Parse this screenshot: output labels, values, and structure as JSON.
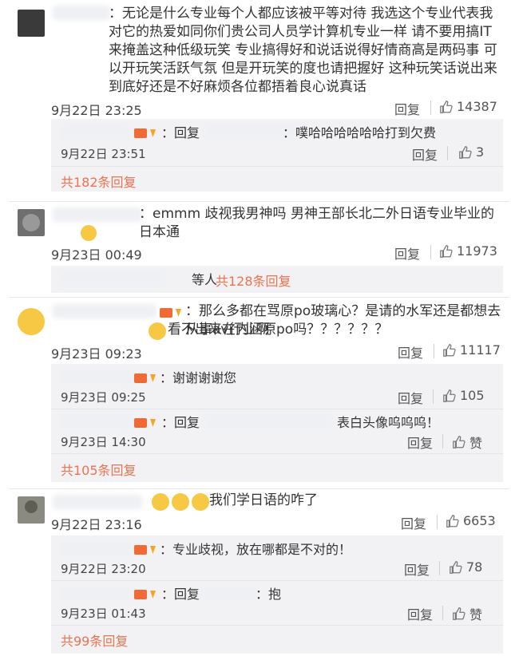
{
  "comments": [
    {
      "text": "：无论是什么专业每个人都应该被平等对待 我选这个专业代表我对它的热爱如同你们贵公司人员学计算机专业一样 请不要用搞IT来掩盖这种低级玩笑 专业搞得好和说话说得好情商高是两码事 可以开玩笑活跃气氛 但是开玩笑的度也请把握好 这种玩笑话说出来到底好还是不好麻烦各位都捂着良心说真话",
      "time": "9月22日 23:25",
      "reply": "回复",
      "likes": "14387",
      "subs": [
        {
          "text": "：回复",
          "text2": "：噗哈哈哈哈哈哈打到欠费",
          "time": "9月22日 23:51",
          "reply": "回复",
          "likes": "3"
        }
      ],
      "more": "共182条回复"
    },
    {
      "text": "：emmm 歧视我男神吗 男神王部长北二外日语专业毕业的日本通",
      "time": "9月23日 00:49",
      "reply": "回复",
      "likes": "11973",
      "more_prefix": "等人",
      "more": "共128条回复"
    },
    {
      "text": "：那么多都在骂原po玻璃心？是请的水军还是都想去从事av行业啊",
      "text_b": "看不出来在内涵原po吗？？？？？？",
      "time": "9月23日 09:23",
      "reply": "回复",
      "likes": "11117",
      "subs": [
        {
          "text": "：谢谢谢谢您",
          "time": "9月23日 09:25",
          "reply": "回复",
          "likes": "105"
        },
        {
          "text": "：回复",
          "text2": "表白头像呜呜呜！",
          "time": "9月23日 14:30",
          "reply": "回复",
          "likes": "赞"
        }
      ],
      "more": "共105条回复"
    },
    {
      "text": "我们学日语的咋了",
      "time": "9月22日 23:16",
      "reply": "回复",
      "likes": "6653",
      "subs": [
        {
          "text": "：专业歧视，放在哪都是不对的！",
          "time": "9月22日 23:20",
          "reply": "回复",
          "likes": "78"
        },
        {
          "text": "：回复",
          "text2": "：抱",
          "time": "9月23日 01:43",
          "reply": "回复",
          "likes": "赞"
        }
      ],
      "more": "共99条回复"
    }
  ],
  "colors": {
    "link": "#eb7350",
    "sub_bg": "#f2f2f5"
  }
}
